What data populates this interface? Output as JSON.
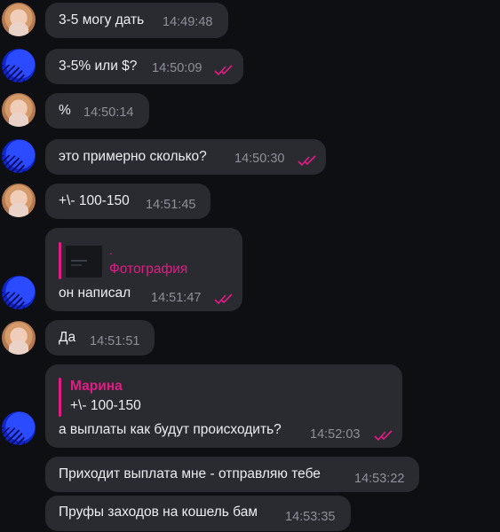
{
  "colors": {
    "background": "#0e0f13",
    "bubble": "#2a2b30",
    "accent": "#e11d85",
    "time": "#8e9199"
  },
  "messages": [
    {
      "sender": "woman",
      "text": "3-5 могу дать",
      "time": "14:49:48"
    },
    {
      "sender": "blue",
      "text": "3-5% или $?",
      "time": "14:50:09",
      "read": true
    },
    {
      "sender": "woman",
      "text": "%",
      "time": "14:50:14"
    },
    {
      "sender": "blue",
      "text": "это примерно сколько?",
      "time": "14:50:30",
      "read": true
    },
    {
      "sender": "woman",
      "text": "+\\- 100-150",
      "time": "14:51:45"
    },
    {
      "sender": "blue",
      "reply": {
        "dot": ".",
        "label": "Фотография"
      },
      "text": "он написал",
      "time": "14:51:47",
      "read": true
    },
    {
      "sender": "woman",
      "text": "Да",
      "time": "14:51:51"
    },
    {
      "sender": "blue",
      "quote": {
        "name": "Марина",
        "text": "+\\- 100-150"
      },
      "text": "а выплаты как будут происходить?",
      "time": "14:52:03",
      "read": true
    },
    {
      "sender": "woman",
      "text": "Приходит выплата мне - отправляю тебе",
      "time": "14:53:22"
    },
    {
      "sender": "woman",
      "text": "Пруфы заходов на кошель бам",
      "time": "14:53:35"
    }
  ]
}
